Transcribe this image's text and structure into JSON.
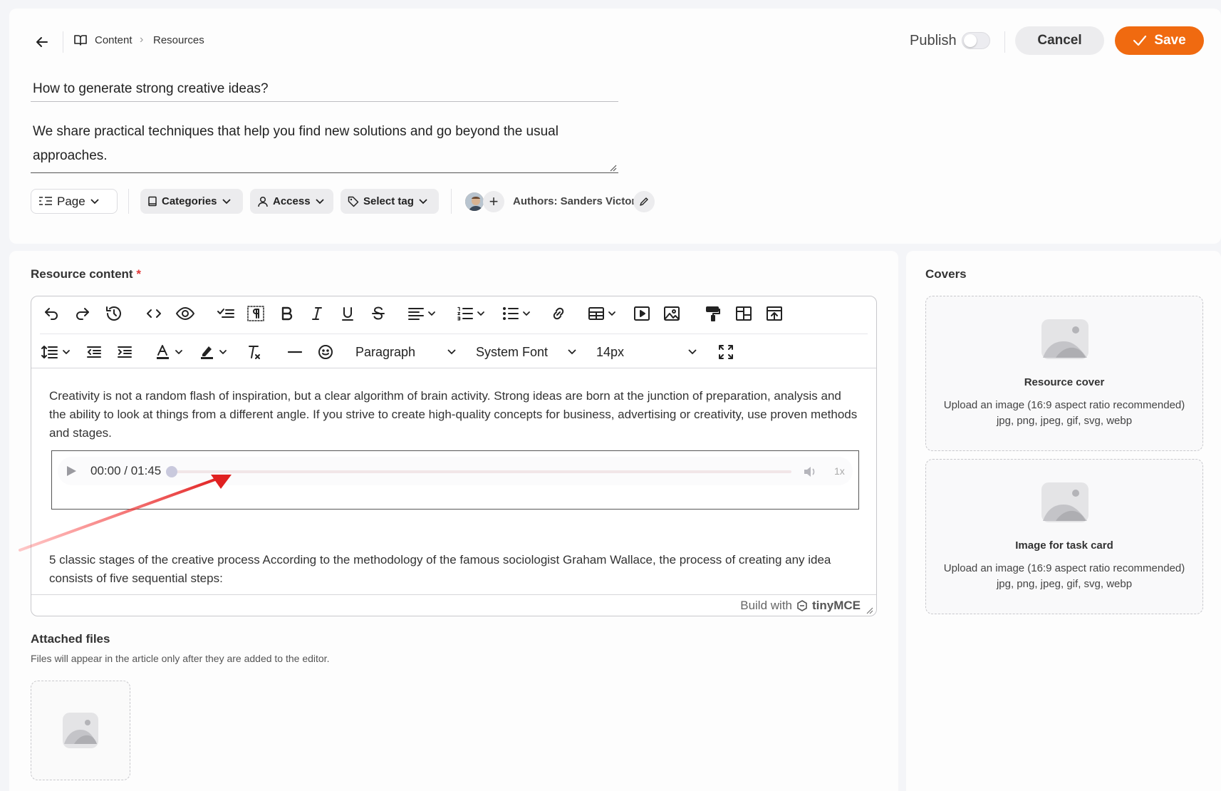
{
  "breadcrumb": {
    "items": [
      "Content",
      "Resources"
    ]
  },
  "header": {
    "publish_label": "Publish",
    "publish_on": false,
    "cancel_label": "Cancel",
    "save_label": "Save"
  },
  "form": {
    "title": "How to generate strong creative ideas?",
    "description": "We share practical techniques that help you find new solutions and go beyond the usual approaches."
  },
  "meta_chips": {
    "page": "Page",
    "categories": "Categories",
    "access": "Access",
    "tags": "Select tag"
  },
  "authors": {
    "label": "Authors: Sanders Victor"
  },
  "content": {
    "label": "Resource content",
    "required_mark": "*",
    "toolbar": {
      "block_format": "Paragraph",
      "font_family": "System Font",
      "font_size": "14px"
    },
    "paragraph_1": "Creativity is not a random flash of inspiration, but a clear algorithm of brain activity. Strong ideas are born at the junction of preparation, analysis and the ability to look at things from a different angle. If you strive to create high-quality concepts for business, advertising or creativity, use proven methods and stages.",
    "audio": {
      "time": "00:00 / 01:45",
      "speed": "1x",
      "progress": 0
    },
    "paragraph_2": "5 classic stages of the creative process According to the methodology of the famous sociologist Graham Wallace, the process of creating any idea consists of five sequential steps:",
    "brand_prefix": "Build with",
    "brand_name": "tinyMCE"
  },
  "attached": {
    "title": "Attached files",
    "hint": "Files will appear in the article only after they are added to the editor."
  },
  "covers": {
    "title": "Covers",
    "cards": [
      {
        "title": "Resource cover",
        "line1": "Upload an image (16:9 aspect ratio recommended)",
        "line2": "jpg, png, jpeg, gif, svg, webp"
      },
      {
        "title": "Image for task card",
        "line1": "Upload an image (16:9 aspect ratio recommended)",
        "line2": "jpg, png, jpeg, gif, svg, webp"
      }
    ]
  },
  "colors": {
    "accent": "#f06a10",
    "annotation_arrow": "#e02020"
  }
}
